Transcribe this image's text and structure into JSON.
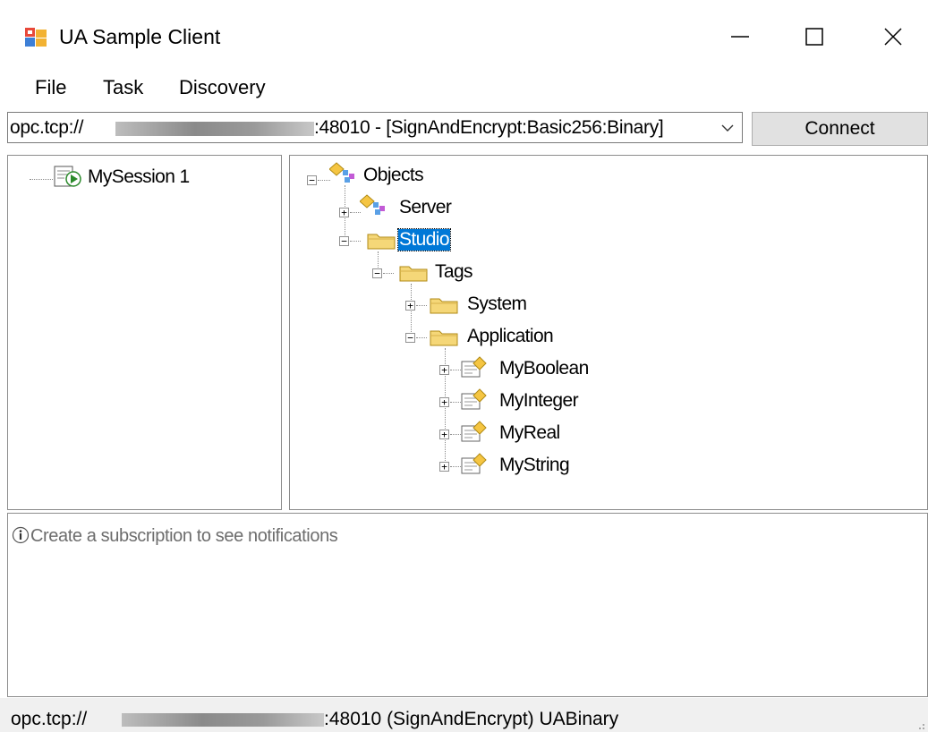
{
  "window": {
    "title": "UA Sample Client",
    "controls": {
      "minimize": "—",
      "maximize": "☐",
      "close": "✕"
    }
  },
  "menu": [
    "File",
    "Task",
    "Discovery"
  ],
  "endpoint": {
    "prefix": "opc.tcp://",
    "suffix": ":48010 - [SignAndEncrypt:Basic256:Binary]"
  },
  "connect_label": "Connect",
  "sessions": [
    {
      "label": "MySession 1",
      "icon": "session-play-icon"
    }
  ],
  "address_space": {
    "root": "Objects",
    "server": "Server",
    "studio": "Studio",
    "tags": "Tags",
    "system": "System",
    "application": "Application",
    "variables": [
      "MyBoolean",
      "MyInteger",
      "MyReal",
      "MyString"
    ],
    "selected": "Studio"
  },
  "notifications": {
    "empty_message": "Create a subscription to see notifications",
    "icon": "info-icon"
  },
  "status": {
    "prefix": "opc.tcp://",
    "suffix": ":48010 (SignAndEncrypt) UABinary"
  },
  "colors": {
    "selection": "#0078d7",
    "folder": "#f5d778",
    "border": "#8c8c8c",
    "statusbar": "#f0f0f0"
  }
}
